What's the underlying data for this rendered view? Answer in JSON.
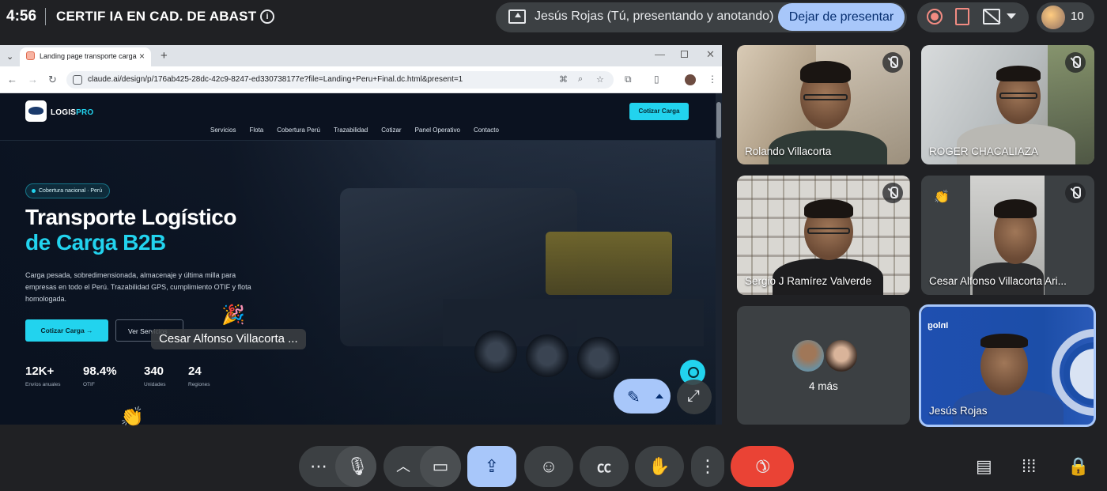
{
  "topbar": {
    "time": "4:56",
    "meeting_title": "CERTIF IA EN CAD. DE ABAST",
    "presenting_text": "Jesús Rojas (Tú, presentando y anotando)",
    "stop_presenting_label": "Dejar de presentar",
    "participant_count": "10"
  },
  "browser": {
    "tab_title": "Landing page transporte carga",
    "url": "claude.ai/design/p/176ab425-28dc-42c9-8247-ed330738177e?file=Landing+Peru+Final.dc.html&present=1"
  },
  "site": {
    "logo_main": "LOGIS",
    "logo_accent": "PRO",
    "nav_cta": "Cotizar Carga",
    "nav_links": [
      "Servicios",
      "Flota",
      "Cobertura Perú",
      "Trazabilidad",
      "Cotizar",
      "Panel Operativo",
      "Contacto"
    ],
    "badge": "Cobertura nacional · Perú",
    "headline_1": "Transporte Logístico",
    "headline_2": "de Carga B2B",
    "description": "Carga pesada, sobredimensionada, almacenaje y última milla para empresas en todo el Perú. Trazabilidad GPS, cumplimiento OTIF y flota homologada.",
    "btn_primary": "Cotizar Carga →",
    "btn_secondary": "Ver Servicios",
    "stats": [
      {
        "value": "12K+",
        "label": "Envíos anuales"
      },
      {
        "value": "98.4%",
        "label": "OTIF"
      },
      {
        "value": "340",
        "label": "Unidades"
      },
      {
        "value": "24",
        "label": "Regiones"
      }
    ]
  },
  "overlay": {
    "speaker_tooltip": "Cesar Alfonso Villacorta ..."
  },
  "tiles": {
    "t1": "Rolando Villacorta",
    "t2": "ROGER CHACALIAZA",
    "t3": "Sergio J Ramírez Valverde",
    "t4": "Cesar Alfonso Villacorta Ari...",
    "more": "4 más",
    "self": "Jesús Rojas",
    "self_bg_text": "Inlog"
  },
  "colors": {
    "accent": "#22d3ee",
    "meet_blue": "#a8c7fa",
    "end_call": "#ea4335"
  }
}
